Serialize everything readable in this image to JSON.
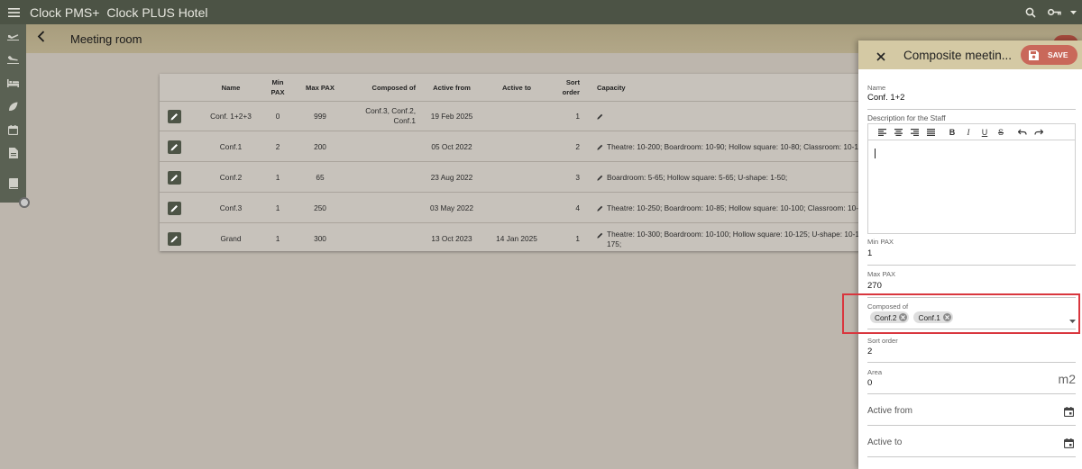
{
  "topbar": {
    "app_name": "Clock PMS+",
    "hotel_name": "Clock PLUS Hotel"
  },
  "page": {
    "title": "Meeting room"
  },
  "table": {
    "headers": {
      "name": "Name",
      "min_pax": "Min PAX",
      "max_pax": "Max PAX",
      "composed_of": "Composed of",
      "active_from": "Active from",
      "active_to": "Active to",
      "sort_order": "Sort order",
      "capacity": "Capacity"
    },
    "rows": [
      {
        "name": "Conf. 1+2+3",
        "min_pax": "0",
        "max_pax": "999",
        "composed_of": "Conf.3, Conf.2, Conf.1",
        "active_from": "19 Feb 2025",
        "active_to": "",
        "sort_order": "1",
        "capacity": ""
      },
      {
        "name": "Conf.1",
        "min_pax": "2",
        "max_pax": "200",
        "composed_of": "",
        "active_from": "05 Oct 2022",
        "active_to": "",
        "sort_order": "2",
        "capacity": "Theatre: 10-200; Boardroom: 10-90; Hollow square: 10-80; Classroom: 10-120"
      },
      {
        "name": "Conf.2",
        "min_pax": "1",
        "max_pax": "65",
        "composed_of": "",
        "active_from": "23 Aug 2022",
        "active_to": "",
        "sort_order": "3",
        "capacity": "Boardroom: 5-65; Hollow square: 5-65; U-shape: 1-50;"
      },
      {
        "name": "Conf.3",
        "min_pax": "1",
        "max_pax": "250",
        "composed_of": "",
        "active_from": "03 May 2022",
        "active_to": "",
        "sort_order": "4",
        "capacity": "Theatre: 10-250; Boardroom: 10-85; Hollow square: 10-100; Classroom: 10-20"
      },
      {
        "name": "Grand",
        "min_pax": "1",
        "max_pax": "300",
        "composed_of": "",
        "active_from": "13 Oct 2023",
        "active_to": "14 Jan 2025",
        "sort_order": "1",
        "capacity": "Theatre: 10-300; Boardroom: 10-100; Hollow square: 10-125; U-shape: 10-100 175;"
      }
    ]
  },
  "panel": {
    "title": "Composite meetin...",
    "save_label": "SAVE",
    "name_label": "Name",
    "name_value": "Conf. 1+2",
    "description_label": "Description for the Staff",
    "min_pax_label": "Min PAX",
    "min_pax_value": "1",
    "max_pax_label": "Max PAX",
    "max_pax_value": "270",
    "composed_label": "Composed of",
    "composed_chips": [
      "Conf.2",
      "Conf.1"
    ],
    "sort_label": "Sort order",
    "sort_value": "2",
    "area_label": "Area",
    "area_value": "0",
    "area_unit": "m2",
    "active_from_label": "Active from",
    "active_to_label": "Active to"
  },
  "colors": {
    "topbar": "#4c5345",
    "save_button": "#c9685a",
    "highlight": "#d9363e"
  }
}
